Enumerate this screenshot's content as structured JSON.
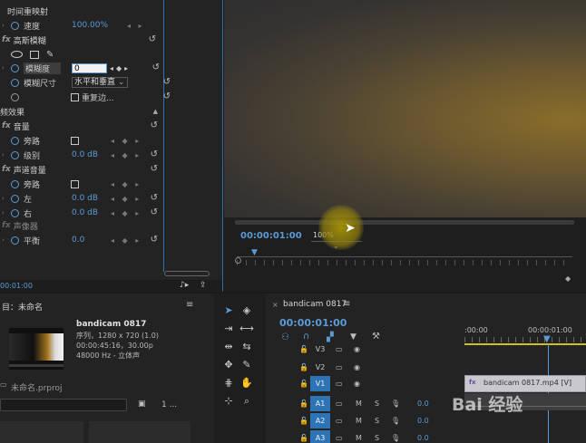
{
  "effects": {
    "time_remap": "时间重映射",
    "speed_label": "速度",
    "speed_value": "100.00%",
    "blur_section": "高斯模糊",
    "blurriness_label": "模糊度",
    "blurriness_value": "0",
    "blur_dim_label": "模糊尺寸",
    "blur_dim_value": "水平和垂直",
    "repeat_edge_label": "重复边...",
    "audio_effects": "频效果",
    "volume_section": "音量",
    "bypass_label": "旁路",
    "level_label": "级别",
    "level_value": "0.0 dB",
    "channel_volume_section": "声道音量",
    "bypass2_label": "旁路",
    "left_label": "左",
    "left_value": "0.0 dB",
    "right_label": "右",
    "right_value": "0.0 dB",
    "panner_section": "声像器",
    "balance_label": "平衡",
    "balance_value": "0.0",
    "timecode": "00:01:00"
  },
  "monitor": {
    "timecode": "00:00:01:00",
    "zoom": "100%"
  },
  "project": {
    "title": "目：未命名",
    "clip_name": "bandicam 0817",
    "clip_seq": "序列，1280 x 720 (1.0)",
    "clip_dur": "00:00:45:16，30.00p",
    "clip_audio": "48000 Hz - 立体声",
    "project_file": "未命名.prproj",
    "search_count": "1 ..."
  },
  "timeline": {
    "tab": "bandicam 0817",
    "timecode": "00:00:01:00",
    "ruler_start": ":00:00",
    "ruler_mark": "00:00:01:00",
    "clip_label": "bandicam 0817.mp4 [V]",
    "tracks": [
      {
        "name": "V3",
        "on": false
      },
      {
        "name": "V2",
        "on": false
      },
      {
        "name": "V1",
        "on": true
      },
      {
        "name": "A1",
        "on": true
      },
      {
        "name": "A2",
        "on": true
      },
      {
        "name": "A3",
        "on": true
      }
    ],
    "audio_m": "M",
    "audio_s": "S",
    "audio_val": "0.0"
  },
  "watermark": "Bai 经验"
}
